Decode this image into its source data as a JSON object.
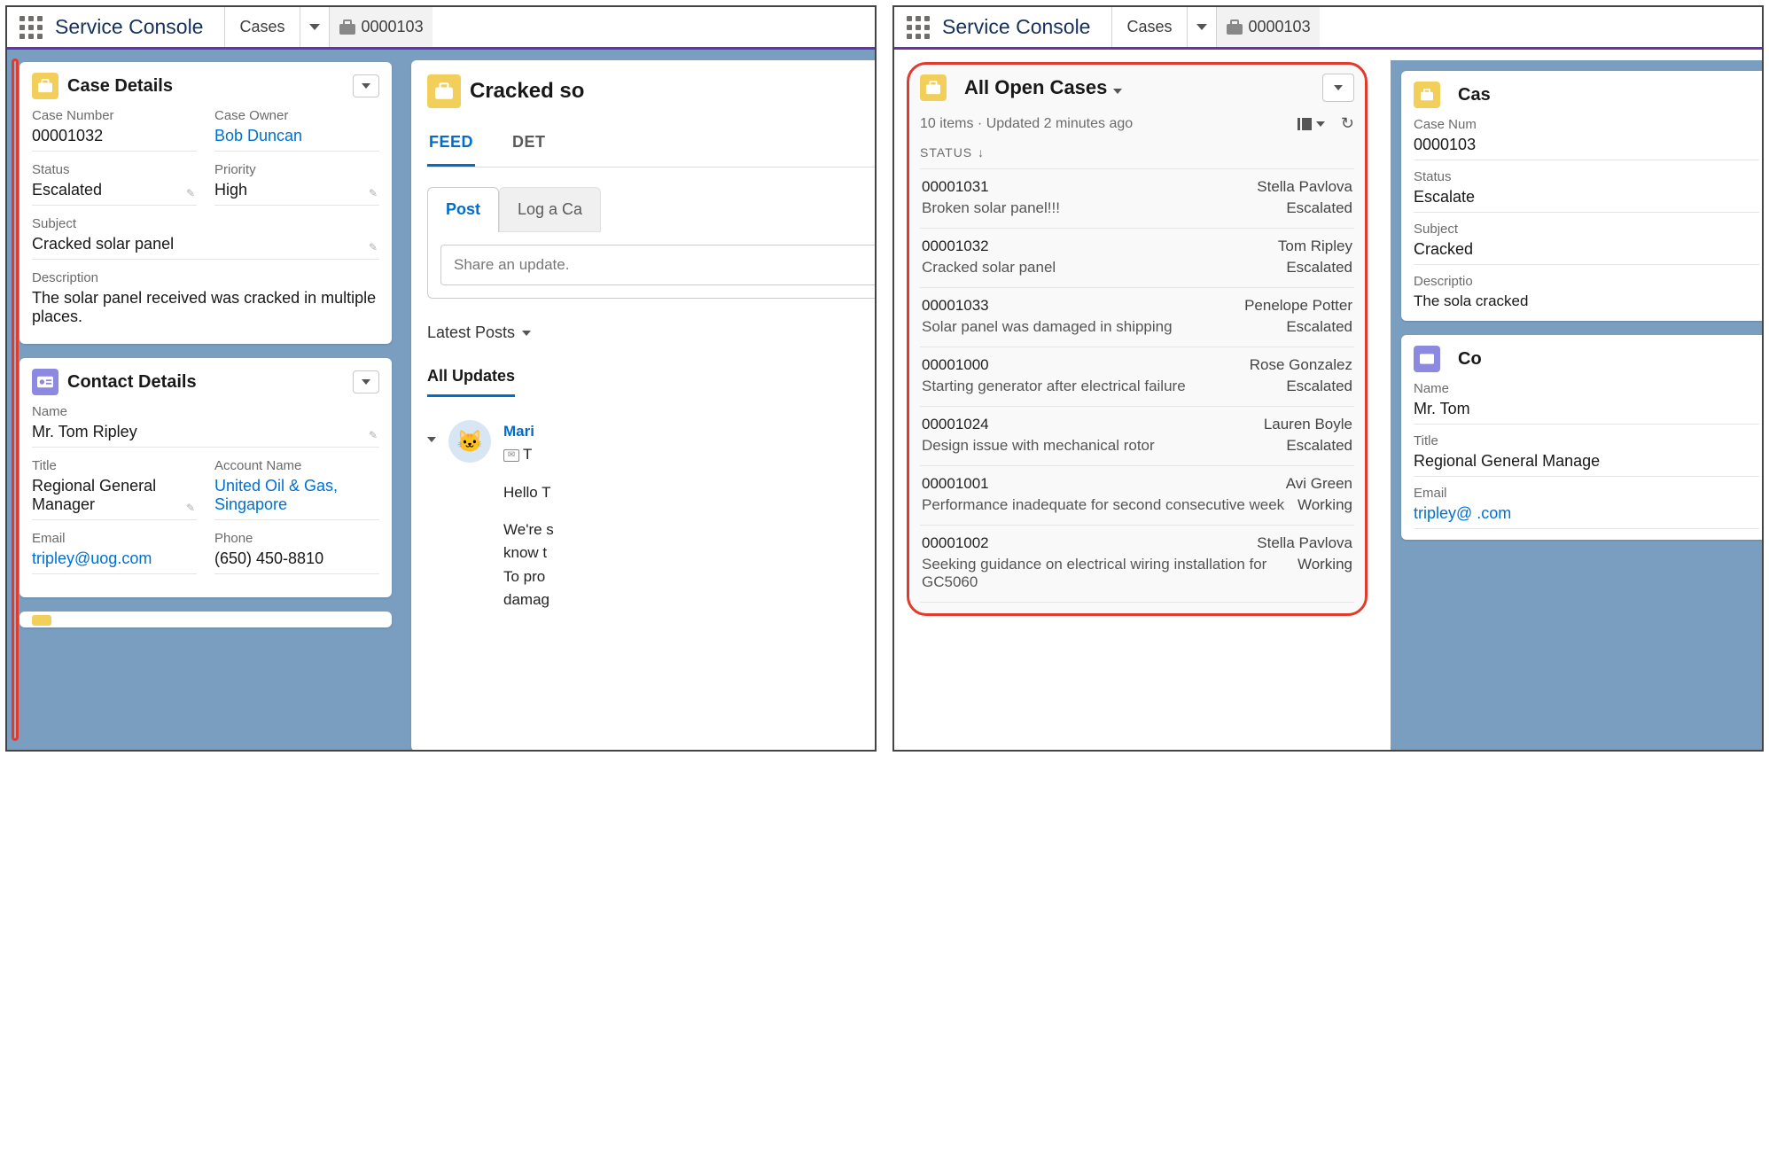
{
  "left": {
    "nav": {
      "app_title": "Service Console",
      "item": "Cases",
      "tab": "0000103"
    },
    "case_details": {
      "title": "Case Details",
      "labels": {
        "case_number": "Case Number",
        "case_owner": "Case Owner",
        "status": "Status",
        "priority": "Priority",
        "subject": "Subject",
        "description": "Description"
      },
      "values": {
        "case_number": "00001032",
        "case_owner": "Bob Duncan",
        "status": "Escalated",
        "priority": "High",
        "subject": "Cracked solar panel",
        "description": "The solar panel received was cracked in multiple places."
      }
    },
    "contact_details": {
      "title": "Contact Details",
      "labels": {
        "name": "Name",
        "title": "Title",
        "account": "Account Name",
        "email": "Email",
        "phone": "Phone"
      },
      "values": {
        "name": "Mr. Tom Ripley",
        "title": "Regional General Manager",
        "account": "United Oil & Gas, Singapore",
        "email": "tripley@uog.com",
        "phone": "(650) 450-8810"
      }
    },
    "main": {
      "title": "Cracked so",
      "tabs": {
        "feed": "FEED",
        "details": "DET"
      },
      "composer": {
        "post": "Post",
        "log": "Log a Ca",
        "placeholder": "Share an update."
      },
      "filter": "Latest Posts",
      "subtab": "All Updates",
      "feed_item": {
        "name": "Mari",
        "to": "T",
        "p1": "Hello T",
        "p2": "We're s",
        "p3": "know t",
        "p4": "To pro",
        "p5": "damag"
      }
    }
  },
  "right": {
    "nav": {
      "app_title": "Service Console",
      "item": "Cases",
      "tab": "0000103"
    },
    "open_cases": {
      "title": "All Open Cases",
      "meta": "10 items · Updated 2 minutes ago",
      "status_label": "STATUS",
      "rows": [
        {
          "num": "00001031",
          "owner": "Stella Pavlova",
          "subj": "Broken solar panel!!!",
          "status": "Escalated"
        },
        {
          "num": "00001032",
          "owner": "Tom Ripley",
          "subj": "Cracked solar panel",
          "status": "Escalated"
        },
        {
          "num": "00001033",
          "owner": "Penelope Potter",
          "subj": "Solar panel was damaged in shipping",
          "status": "Escalated"
        },
        {
          "num": "00001000",
          "owner": "Rose Gonzalez",
          "subj": "Starting generator after electrical failure",
          "status": "Escalated"
        },
        {
          "num": "00001024",
          "owner": "Lauren Boyle",
          "subj": "Design issue with mechanical rotor",
          "status": "Escalated"
        },
        {
          "num": "00001001",
          "owner": "Avi Green",
          "subj": "Performance inadequate for second consecutive week",
          "status": "Working"
        },
        {
          "num": "00001002",
          "owner": "Stella Pavlova",
          "subj": "Seeking guidance on electrical wiring installation for GC5060",
          "status": "Working"
        }
      ]
    },
    "side_case": {
      "title": "Cas",
      "labels": {
        "case_number": "Case Num",
        "status": "Status",
        "subject": "Subject",
        "description": "Descriptio"
      },
      "values": {
        "case_number": "0000103",
        "status": "Escalate",
        "subject": "Cracked",
        "description": "The sola cracked "
      }
    },
    "side_contact": {
      "title": "Co",
      "labels": {
        "name": "Name",
        "title": "Title",
        "email": "Email"
      },
      "values": {
        "name": "Mr. Tom",
        "title": "Regional General Manage",
        "email": "tripley@ .com"
      }
    }
  }
}
